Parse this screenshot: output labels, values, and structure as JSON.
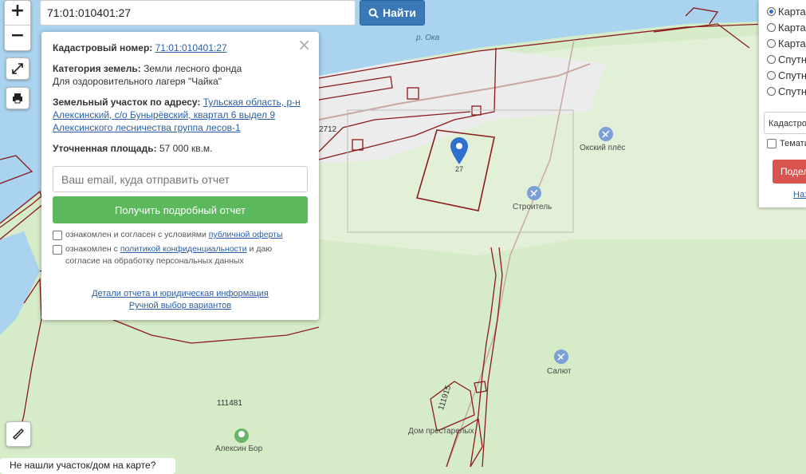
{
  "search": {
    "value": "71:01:010401:27",
    "button_label": "Найти"
  },
  "zoom": {
    "in": "+",
    "out": "−"
  },
  "popup": {
    "cadastral_label": "Кадастровый номер:",
    "cadastral_value": "71:01:010401:27",
    "category_label": "Категория земель:",
    "category_value": "Земли лесного фонда",
    "category_use": "Для оздоровительного лагеря \"Чайка\"",
    "address_label": "Земельный участок по адресу:",
    "address_value": "Тульская область, р-н Алексинский, с/о Бунырёвский, квартал 6 выдел 9 Алексинского лесничества группа лесов-1",
    "area_label": "Уточненная площадь:",
    "area_value": "57 000 кв.м.",
    "email_placeholder": "Ваш email, куда отправить отчет",
    "report_button": "Получить подробный отчет",
    "check1_text": "ознакомлен и согласен с условиями",
    "check1_link": "публичной оферты",
    "check2_text": "ознакомлен с",
    "check2_link": "политикой конфиденциальности",
    "check2_text2": "и даю согласие на обработку персональных данных",
    "link_details": "Детали отчета и юридическая информация",
    "link_manual": "Ручной выбор вариантов"
  },
  "map": {
    "river_label": "р. Ока",
    "parcel_number": "27",
    "label_2712": "2712",
    "label_111481": "111481",
    "label_111915": "111915",
    "poi": [
      {
        "name": "Окский плёс"
      },
      {
        "name": "Строитель"
      },
      {
        "name": "Салют"
      },
      {
        "name": "Дом престарелых"
      },
      {
        "name": "Алексин Бор"
      }
    ]
  },
  "right_panel": {
    "radios": [
      "Карта",
      "Карта",
      "Карта",
      "Спутник",
      "Спутник",
      "Спутник"
    ],
    "selected_index": 0,
    "layer_select": "Кадастровый",
    "thematic_label": "Тематические",
    "red_button": "Поделиться",
    "link": "Назад"
  },
  "bottom_question": "Не нашли участок/дом на карте?",
  "colors": {
    "boundary": "#8b1a1a",
    "river": "#a9d3ef",
    "forest": "#d6ebc7",
    "road": "#c9a8a0",
    "green_button": "#5cb85c",
    "blue_button": "#3a78b8",
    "red_button": "#d9534f",
    "marker": "#2f6fce"
  }
}
